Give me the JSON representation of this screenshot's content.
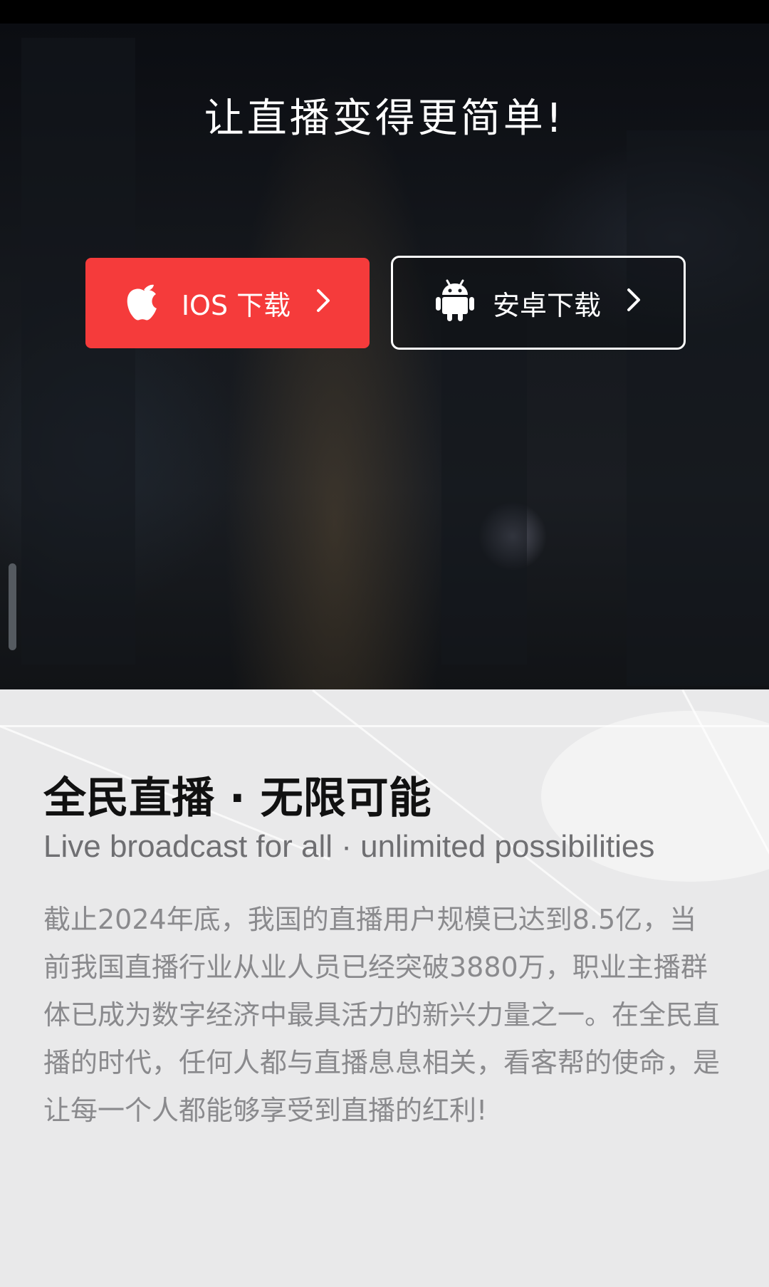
{
  "hero": {
    "title": "让直播变得更简单!",
    "ios_button": {
      "label": "IOS 下载",
      "icon": "apple-icon",
      "chevron": "chevron-right-icon"
    },
    "android_button": {
      "label": "安卓下载",
      "icon": "android-icon",
      "chevron": "chevron-right-icon"
    }
  },
  "section": {
    "title": "全民直播 · 无限可能",
    "subtitle": "Live broadcast for all · unlimited possibilities",
    "body": "截止2024年底，我国的直播用户规模已达到8.5亿，当前我国直播行业从业人员已经突破3880万，职业主播群体已成为数字经济中最具活力的新兴力量之一。在全民直播的时代，任何人都与直播息息相关，看客帮的使命，是让每一个人都能够享受到直播的红利!"
  },
  "colors": {
    "ios_button_bg": "#f53b3b",
    "content_bg": "#e9e9ea",
    "title_text": "#111111",
    "subtitle_text": "#6f6f72",
    "body_text": "#8a8a8d"
  }
}
